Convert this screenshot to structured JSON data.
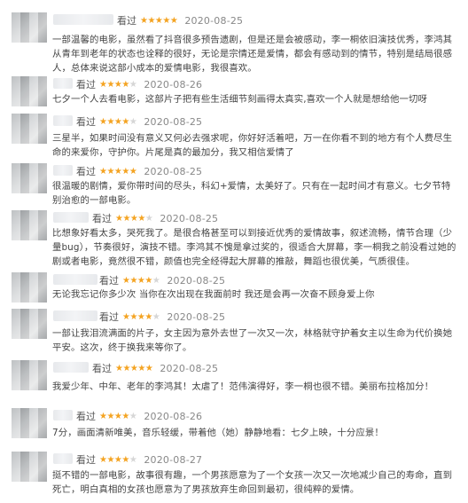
{
  "reviews": [
    {
      "label": "看过",
      "stars": 5,
      "date": "2020-08-25",
      "text": "一部温馨的电影，虽然看了抖音很多预告遗剧，但是还是会被感动，李一桐依旧演技优秀，李鸿其从青年到老年的状态也诠释的很好，无论是宗情还是爱情，都会有感动到的情节，特别是结局很感人，总体来说这部小成本的爱情电影，我很喜欢。"
    },
    {
      "label": "看过",
      "stars": 4,
      "date": "2020-08-26",
      "text": "七夕一个人去看电影，这部片子把有些生活细节刻画得太真实,喜欢一个人就是想给他一切呀"
    },
    {
      "label": "看过",
      "stars": 4,
      "date": "2020-08-25",
      "text": "三星半，如果时间没有意义又何必去强求呢，你好好活着吧，万一在你看不到的地方有个人费尽生命的来爱你，守护你。片尾是真的最加分，我又相信爱情了"
    },
    {
      "label": "看过",
      "stars": 5,
      "date": "2020-08-25",
      "text": "很温暖的剧情，爱你带时间的尽头，科幻+爱情，太美好了。只有在一起时间才有意义。七夕节特别治愈的一部电影。"
    },
    {
      "label": "看过",
      "stars": 4,
      "date": "2020-08-25",
      "text": "比想象好看太多，哭死我了。是很合格甚至可以到接近优秀的爱情故事，叙述流畅，情节合理（少量bug），节奏很好，演技不错。李鸿其不愧是拿过奖的，很适合大屏幕，李一桐我之前没看过她的剧或者电影，竟然很不错，颜值也完全经得起大屏幕的推敲，舞蹈也很优美，气质很佳。"
    },
    {
      "label": "看过",
      "stars": 4,
      "date": "2020-08-25",
      "text": "无论我忘记你多少次 当你在次出现在我面前时 我还是会再一次奋不顾身爱上你"
    },
    {
      "label": "看过",
      "stars": 4,
      "date": "2020-08-25",
      "text": "一部让我泪流满面的片子，女主因为意外去世了一次又一次，林格就守护着女主以生命为代价换她平安。这次，终于换我来等你了。"
    },
    {
      "label": "看过",
      "stars": 5,
      "date": "2020-08-25",
      "text": "我爱少年、中年、老年的李鸿其！太虐了！范伟演得好，李一桐也很不错。美丽布拉格加分！"
    },
    {
      "label": "看过",
      "stars": 4,
      "date": "2020-08-26",
      "text": "7分，画面清新唯美，音乐轻缓，带着他（她）静静地看：七夕上映，十分应景！"
    },
    {
      "label": "看过",
      "stars": 4,
      "date": "2020-08-27",
      "text": "挺不错的一部电影，故事很有趣，一个男孩愿意为了一个女孩一次又一次地减少自己的寿命，直到死亡，明白真相的女孩也愿意为了男孩放弃生命回到最初，很纯粹的爱情。"
    }
  ]
}
